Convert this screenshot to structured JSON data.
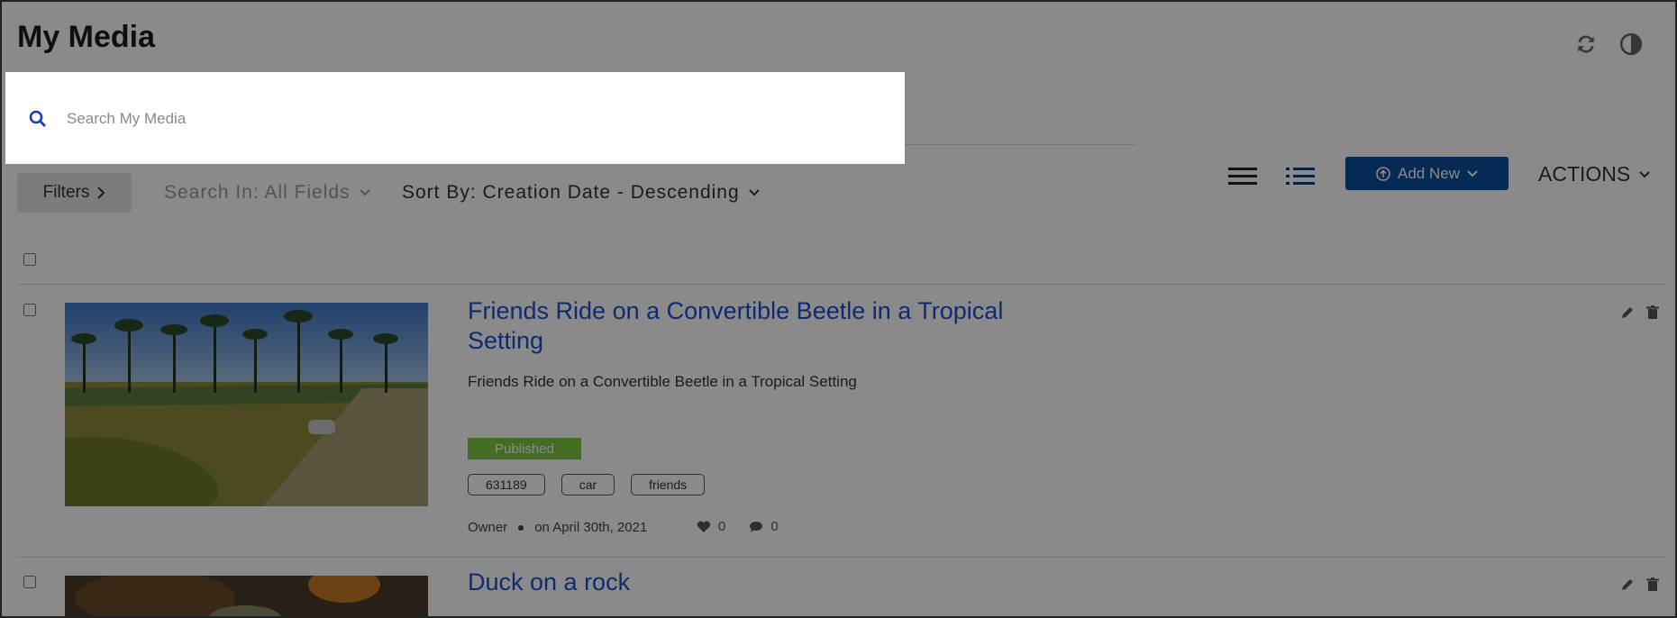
{
  "page": {
    "title": "My Media"
  },
  "header_icons": [
    "refresh-icon",
    "contrast-icon"
  ],
  "search": {
    "placeholder": "Search My Media",
    "value": ""
  },
  "toolbar": {
    "filters_label": "Filters",
    "search_in_label": "Search In: All Fields",
    "sort_by_label": "Sort By: Creation Date - Descending",
    "add_new_label": "Add New",
    "actions_label": "ACTIONS"
  },
  "colors": {
    "accent": "#0b4e9c",
    "link": "#1a4fd0",
    "published": "#7cc943"
  },
  "media": [
    {
      "title": "Friends Ride on a Convertible Beetle in a Tropical Setting",
      "description": "Friends Ride on a Convertible Beetle in a Tropical Setting",
      "status": "Published",
      "tags": [
        "631189",
        "car",
        "friends"
      ],
      "owner": "Owner",
      "date": "on April 30th, 2021",
      "likes": "0",
      "comments": "0"
    },
    {
      "title": "Duck on a rock"
    }
  ]
}
